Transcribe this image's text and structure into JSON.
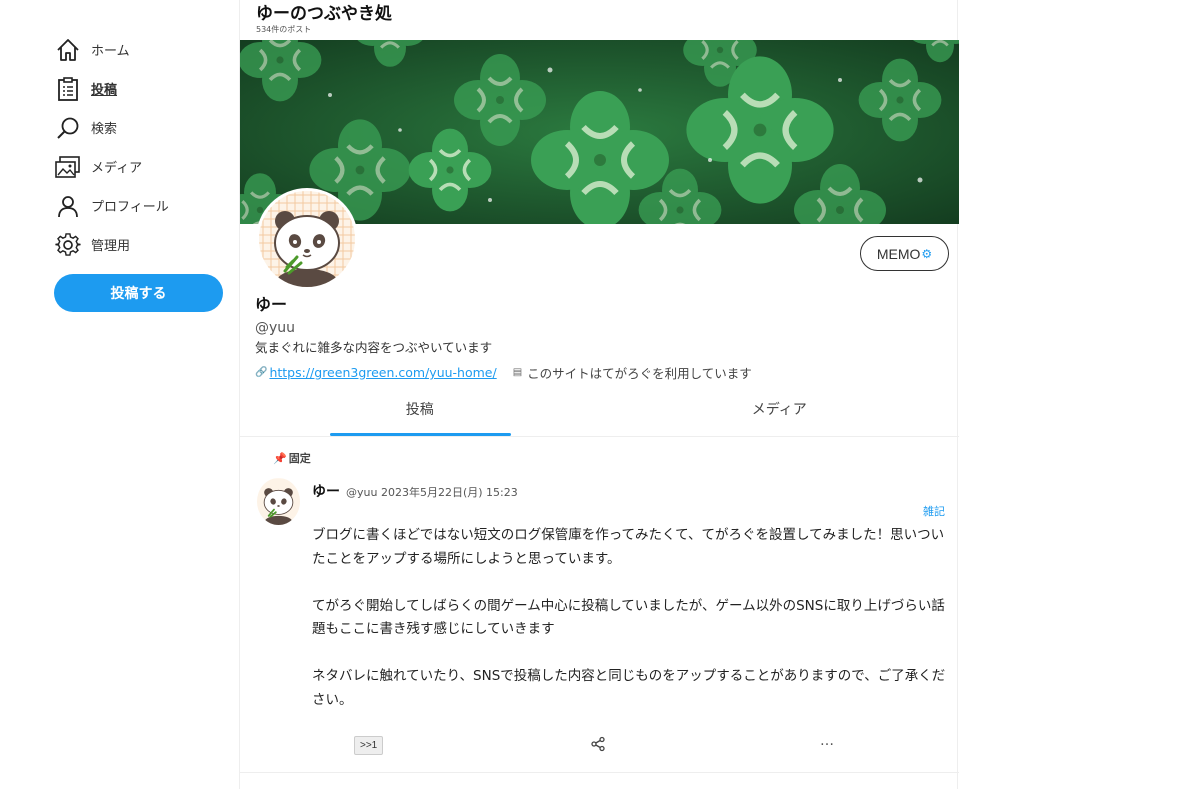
{
  "sidebar": {
    "items": [
      {
        "label": "ホーム",
        "icon": "home-icon"
      },
      {
        "label": "投稿",
        "icon": "clipboard-icon"
      },
      {
        "label": "検索",
        "icon": "search-icon"
      },
      {
        "label": "メディア",
        "icon": "media-icon"
      },
      {
        "label": "プロフィール",
        "icon": "user-icon"
      },
      {
        "label": "管理用",
        "icon": "gear-icon"
      }
    ],
    "post_button": "投稿する"
  },
  "header": {
    "title": "ゆーのつぶやき処",
    "post_count": "534件のポスト"
  },
  "profile": {
    "memo_button": "MEMO",
    "name": "ゆー",
    "handle": "@yuu",
    "bio": "気まぐれに雑多な内容をつぶやいています",
    "link": "https://green3green.com/yuu-home/",
    "usage_note": "このサイトはてがろぐを利用しています"
  },
  "tabs": [
    {
      "label": "投稿",
      "active": true
    },
    {
      "label": "メディア",
      "active": false
    }
  ],
  "post": {
    "pinned_label": "固定",
    "author": "ゆー",
    "meta": "@yuu 2023年5月22日(月) 15:23",
    "category": "雑記",
    "paragraphs": [
      "ブログに書くほどではない短文のログ保管庫を作ってみたくて、てがろぐを設置してみました！思いついたことをアップする場所にしようと思っています。",
      "てがろぐ開始してしばらくの間ゲーム中心に投稿していましたが、ゲーム以外のSNSに取り上げづらい話題もここに書き残す感じにしていきます",
      "ネタバレに触れていたり、SNSで投稿した内容と同じものをアップすることがありますので、ご了承ください。"
    ],
    "reply_label": ">>1",
    "more_label": "…"
  },
  "colors": {
    "accent": "#1d9bf0",
    "banner_green": "#2e8b47"
  }
}
